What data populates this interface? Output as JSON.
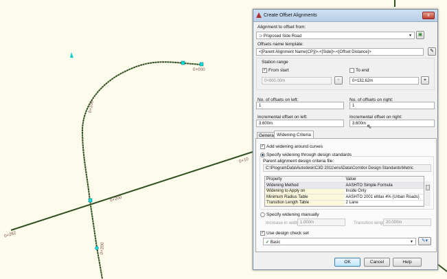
{
  "canvas": {
    "station_labels": [
      "0+000",
      "0+100",
      "0+200",
      "0+282",
      "0+200",
      "0+10"
    ]
  },
  "dialog": {
    "title": "Create Offset Alignments",
    "close_label": "x",
    "alignment_label": "Alignment to offset from:",
    "alignment_value": "Proposed Side Road",
    "template_label": "Offsets name template:",
    "template_value": "<[Parent Alignment Name(CP)]>-<[Side]>-<[Offset Distance]>",
    "station_range": {
      "title": "Station range",
      "from_start_label": "From start",
      "from_start_checked": true,
      "from_value": "0+000.00m",
      "to_end_label": "To end",
      "to_end_checked": false,
      "to_value": "0+132.62m"
    },
    "offsets_left_label": "No. of offsets on left:",
    "offsets_left_value": "1",
    "offsets_right_label": "No. of offsets on right:",
    "offsets_right_value": "1",
    "inc_left_label": "Incremental offset on left:",
    "inc_left_value": "3.600m",
    "inc_right_label": "Incremental offset on right:",
    "inc_right_value": "3.600m",
    "tabs": [
      {
        "label": "General"
      },
      {
        "label": "Widening Criteria",
        "active": true
      }
    ],
    "widening": {
      "add_label": "Add widening around curves",
      "add_checked": true,
      "standards_label": "Specify widening through design standards",
      "criteria_file_label": "Parent alignment design criteria file:",
      "criteria_file_value": "C:\\ProgramData\\Autodesk\\C3D 2011\\enu\\Data\\Corridor Design Standards\\Metric",
      "table": {
        "headers": [
          "Property",
          "Value"
        ],
        "rows": [
          [
            "Widening Method",
            "AASHTO Simple Formula"
          ],
          [
            "Widening to Apply on",
            "Inside Only"
          ],
          [
            "Minimum Radius Table",
            "AASHTO 2001 eMax 4% (Urban Roads)"
          ],
          [
            "Transition Length Table",
            "2 Lane"
          ]
        ]
      },
      "manual_label": "Specify widening manually",
      "increase_label": "Increase in width:",
      "increase_value": "1.000m",
      "transition_label": "Transition length:",
      "transition_value": "20.000m",
      "check_set_label": "Use design check set",
      "check_set_checked": true,
      "check_set_value": "Basic"
    },
    "buttons": {
      "ok": "OK",
      "cancel": "Cancel",
      "help": "Help"
    }
  }
}
